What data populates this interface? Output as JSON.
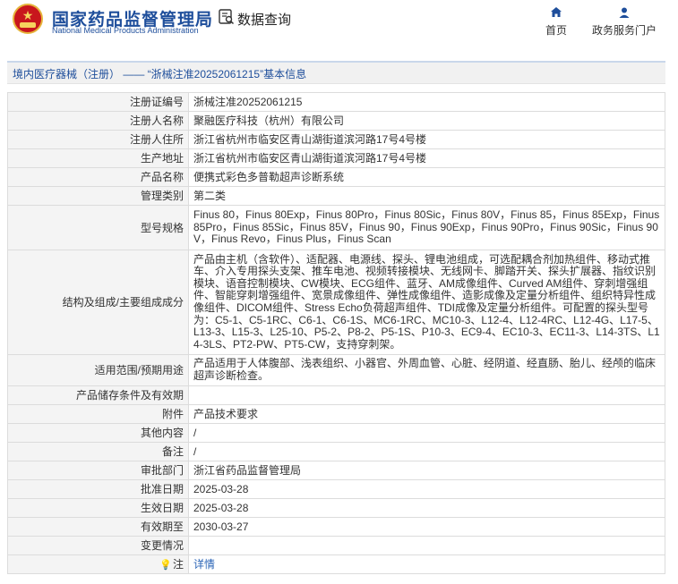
{
  "header": {
    "brand_cn": "国家药品监督管理局",
    "brand_en": "National Medical Products Administration",
    "data_query": "数据查询",
    "nav_home": "首页",
    "nav_portal": "政务服务门户",
    "brand_color": "#1e4e9b"
  },
  "title": "境内医疗器械（注册） —— “浙械注准20252061215”基本信息",
  "rows": [
    {
      "label": "注册证编号",
      "value": "浙械注准20252061215"
    },
    {
      "label": "注册人名称",
      "value": "聚融医疗科技（杭州）有限公司"
    },
    {
      "label": "注册人住所",
      "value": "浙江省杭州市临安区青山湖街道滨河路17号4号楼"
    },
    {
      "label": "生产地址",
      "value": "浙江省杭州市临安区青山湖街道滨河路17号4号楼"
    },
    {
      "label": "产品名称",
      "value": "便携式彩色多普勒超声诊断系统"
    },
    {
      "label": "管理类别",
      "value": "第二类"
    },
    {
      "label": "型号规格",
      "value": "Finus 80，Finus 80Exp，Finus 80Pro，Finus 80Sic，Finus 80V，Finus 85，Finus 85Exp，Finus 85Pro，Finus 85Sic，Finus 85V，Finus 90，Finus 90Exp，Finus 90Pro，Finus 90Sic，Finus 90V，Finus Revo，Finus Plus，Finus Scan"
    },
    {
      "label": "结构及组成/主要组成成分",
      "value": "产品由主机（含软件）、适配器、电源线、探头、锂电池组成，可选配耦合剂加热组件、移动式推车、介入专用探头支架、推车电池、视频转接模块、无线网卡、脚踏开关、探头扩展器、指纹识别模块、语音控制模块、CW模块、ECG组件、蓝牙、AM成像组件、Curved AM组件、穿刺增强组件、智能穿刺增强组件、宽景成像组件、弹性成像组件、造影成像及定量分析组件、组织特异性成像组件、DICOM组件、Stress Echo负荷超声组件、TDI成像及定量分析组件。可配置的探头型号为：C5-1、C5-1RC、C6-1、C6-1S、MC6-1RC、MC10-3、L12-4、L12-4RC、L12-4G、L17-5、L13-3、L15-3、L25-10、P5-2、P8-2、P5-1S、P10-3、EC9-4、EC10-3、EC11-3、L14-3TS、L14-3LS、PT2-PW、PT5-CW，支持穿刺架。"
    },
    {
      "label": "适用范围/预期用途",
      "value": "产品适用于人体腹部、浅表组织、小器官、外周血管、心脏、经阴道、经直肠、胎儿、经颅的临床超声诊断检查。"
    },
    {
      "label": "产品储存条件及有效期",
      "value": ""
    },
    {
      "label": "附件",
      "value": "产品技术要求"
    },
    {
      "label": "其他内容",
      "value": "/"
    },
    {
      "label": "备注",
      "value": "/"
    },
    {
      "label": "审批部门",
      "value": "浙江省药品监督管理局"
    },
    {
      "label": "批准日期",
      "value": "2025-03-28"
    },
    {
      "label": "生效日期",
      "value": "2025-03-28"
    },
    {
      "label": "有效期至",
      "value": "2030-03-27"
    },
    {
      "label": "变更情况",
      "value": ""
    },
    {
      "label": "注",
      "value": "详情"
    }
  ]
}
